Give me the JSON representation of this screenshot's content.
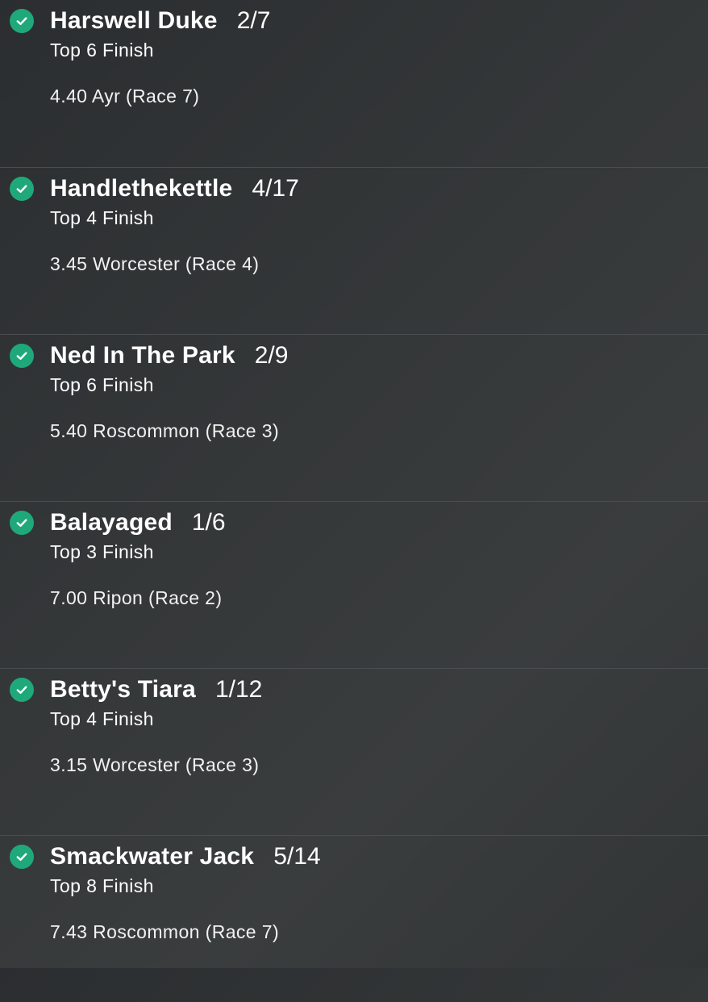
{
  "colors": {
    "check_icon": "#1fa97a",
    "divider": "#4a4e50",
    "text": "#ffffff"
  },
  "selections": [
    {
      "status_icon": "check-icon",
      "runner": "Harswell Duke",
      "odds": "2/7",
      "market": "Top 6 Finish",
      "event": "4.40 Ayr (Race 7)"
    },
    {
      "status_icon": "check-icon",
      "runner": "Handlethekettle",
      "odds": "4/17",
      "market": "Top 4 Finish",
      "event": "3.45 Worcester (Race 4)"
    },
    {
      "status_icon": "check-icon",
      "runner": "Ned In The Park",
      "odds": "2/9",
      "market": "Top 6 Finish",
      "event": "5.40 Roscommon (Race 3)"
    },
    {
      "status_icon": "check-icon",
      "runner": "Balayaged",
      "odds": "1/6",
      "market": "Top 3 Finish",
      "event": "7.00 Ripon (Race 2)"
    },
    {
      "status_icon": "check-icon",
      "runner": "Betty's Tiara",
      "odds": "1/12",
      "market": "Top 4 Finish",
      "event": "3.15 Worcester (Race 3)"
    },
    {
      "status_icon": "check-icon",
      "runner": "Smackwater Jack",
      "odds": "5/14",
      "market": "Top 8 Finish",
      "event": "7.43 Roscommon (Race 7)"
    }
  ]
}
